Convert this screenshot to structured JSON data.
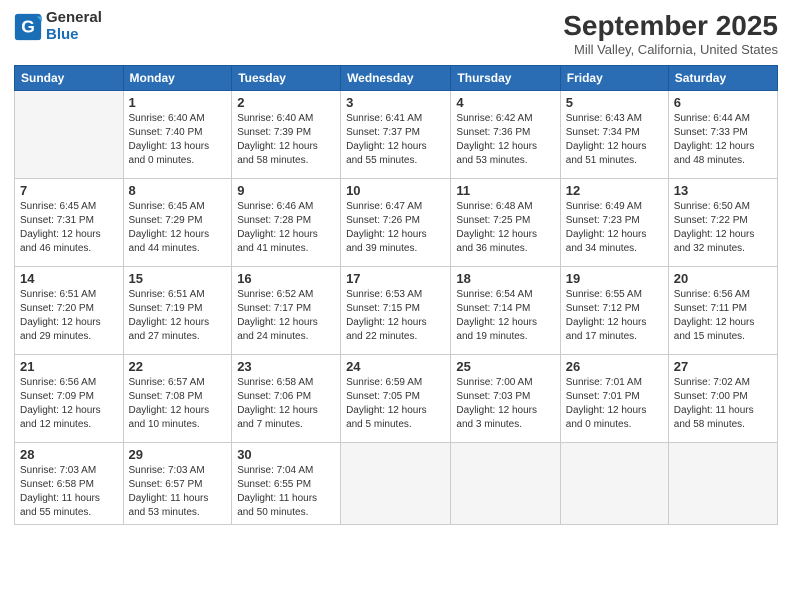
{
  "header": {
    "logo_line1": "General",
    "logo_line2": "Blue",
    "month_title": "September 2025",
    "location": "Mill Valley, California, United States"
  },
  "days_of_week": [
    "Sunday",
    "Monday",
    "Tuesday",
    "Wednesday",
    "Thursday",
    "Friday",
    "Saturday"
  ],
  "weeks": [
    [
      {
        "day": "",
        "info": ""
      },
      {
        "day": "1",
        "info": "Sunrise: 6:40 AM\nSunset: 7:40 PM\nDaylight: 13 hours\nand 0 minutes."
      },
      {
        "day": "2",
        "info": "Sunrise: 6:40 AM\nSunset: 7:39 PM\nDaylight: 12 hours\nand 58 minutes."
      },
      {
        "day": "3",
        "info": "Sunrise: 6:41 AM\nSunset: 7:37 PM\nDaylight: 12 hours\nand 55 minutes."
      },
      {
        "day": "4",
        "info": "Sunrise: 6:42 AM\nSunset: 7:36 PM\nDaylight: 12 hours\nand 53 minutes."
      },
      {
        "day": "5",
        "info": "Sunrise: 6:43 AM\nSunset: 7:34 PM\nDaylight: 12 hours\nand 51 minutes."
      },
      {
        "day": "6",
        "info": "Sunrise: 6:44 AM\nSunset: 7:33 PM\nDaylight: 12 hours\nand 48 minutes."
      }
    ],
    [
      {
        "day": "7",
        "info": "Sunrise: 6:45 AM\nSunset: 7:31 PM\nDaylight: 12 hours\nand 46 minutes."
      },
      {
        "day": "8",
        "info": "Sunrise: 6:45 AM\nSunset: 7:29 PM\nDaylight: 12 hours\nand 44 minutes."
      },
      {
        "day": "9",
        "info": "Sunrise: 6:46 AM\nSunset: 7:28 PM\nDaylight: 12 hours\nand 41 minutes."
      },
      {
        "day": "10",
        "info": "Sunrise: 6:47 AM\nSunset: 7:26 PM\nDaylight: 12 hours\nand 39 minutes."
      },
      {
        "day": "11",
        "info": "Sunrise: 6:48 AM\nSunset: 7:25 PM\nDaylight: 12 hours\nand 36 minutes."
      },
      {
        "day": "12",
        "info": "Sunrise: 6:49 AM\nSunset: 7:23 PM\nDaylight: 12 hours\nand 34 minutes."
      },
      {
        "day": "13",
        "info": "Sunrise: 6:50 AM\nSunset: 7:22 PM\nDaylight: 12 hours\nand 32 minutes."
      }
    ],
    [
      {
        "day": "14",
        "info": "Sunrise: 6:51 AM\nSunset: 7:20 PM\nDaylight: 12 hours\nand 29 minutes."
      },
      {
        "day": "15",
        "info": "Sunrise: 6:51 AM\nSunset: 7:19 PM\nDaylight: 12 hours\nand 27 minutes."
      },
      {
        "day": "16",
        "info": "Sunrise: 6:52 AM\nSunset: 7:17 PM\nDaylight: 12 hours\nand 24 minutes."
      },
      {
        "day": "17",
        "info": "Sunrise: 6:53 AM\nSunset: 7:15 PM\nDaylight: 12 hours\nand 22 minutes."
      },
      {
        "day": "18",
        "info": "Sunrise: 6:54 AM\nSunset: 7:14 PM\nDaylight: 12 hours\nand 19 minutes."
      },
      {
        "day": "19",
        "info": "Sunrise: 6:55 AM\nSunset: 7:12 PM\nDaylight: 12 hours\nand 17 minutes."
      },
      {
        "day": "20",
        "info": "Sunrise: 6:56 AM\nSunset: 7:11 PM\nDaylight: 12 hours\nand 15 minutes."
      }
    ],
    [
      {
        "day": "21",
        "info": "Sunrise: 6:56 AM\nSunset: 7:09 PM\nDaylight: 12 hours\nand 12 minutes."
      },
      {
        "day": "22",
        "info": "Sunrise: 6:57 AM\nSunset: 7:08 PM\nDaylight: 12 hours\nand 10 minutes."
      },
      {
        "day": "23",
        "info": "Sunrise: 6:58 AM\nSunset: 7:06 PM\nDaylight: 12 hours\nand 7 minutes."
      },
      {
        "day": "24",
        "info": "Sunrise: 6:59 AM\nSunset: 7:05 PM\nDaylight: 12 hours\nand 5 minutes."
      },
      {
        "day": "25",
        "info": "Sunrise: 7:00 AM\nSunset: 7:03 PM\nDaylight: 12 hours\nand 3 minutes."
      },
      {
        "day": "26",
        "info": "Sunrise: 7:01 AM\nSunset: 7:01 PM\nDaylight: 12 hours\nand 0 minutes."
      },
      {
        "day": "27",
        "info": "Sunrise: 7:02 AM\nSunset: 7:00 PM\nDaylight: 11 hours\nand 58 minutes."
      }
    ],
    [
      {
        "day": "28",
        "info": "Sunrise: 7:03 AM\nSunset: 6:58 PM\nDaylight: 11 hours\nand 55 minutes."
      },
      {
        "day": "29",
        "info": "Sunrise: 7:03 AM\nSunset: 6:57 PM\nDaylight: 11 hours\nand 53 minutes."
      },
      {
        "day": "30",
        "info": "Sunrise: 7:04 AM\nSunset: 6:55 PM\nDaylight: 11 hours\nand 50 minutes."
      },
      {
        "day": "",
        "info": ""
      },
      {
        "day": "",
        "info": ""
      },
      {
        "day": "",
        "info": ""
      },
      {
        "day": "",
        "info": ""
      }
    ]
  ]
}
